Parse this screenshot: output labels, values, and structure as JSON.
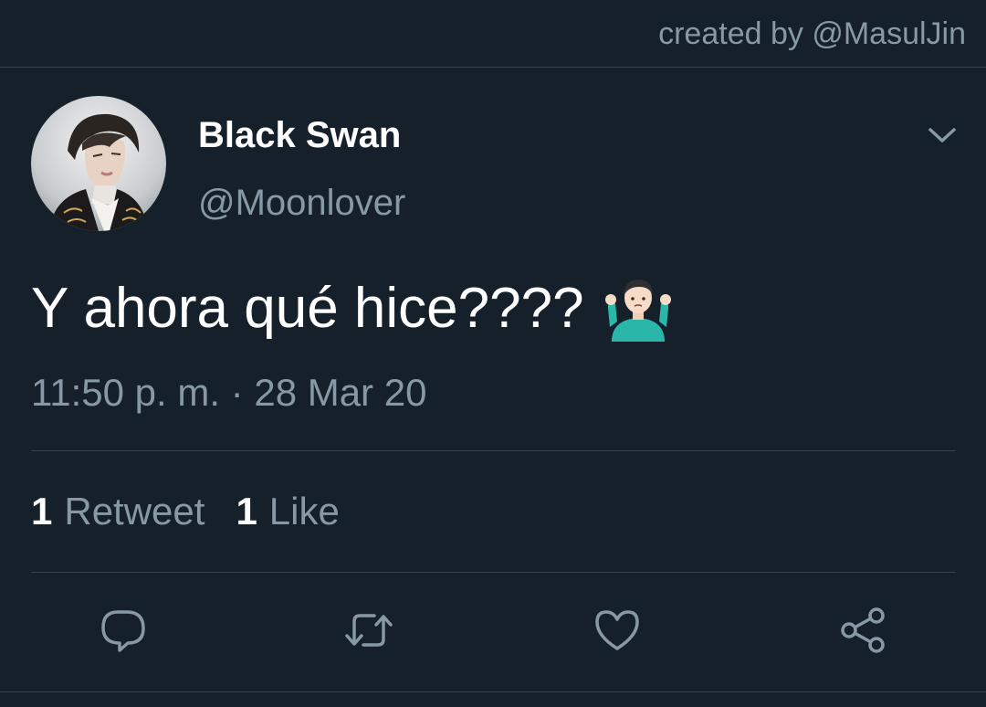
{
  "watermark": {
    "credit": "created by @MasulJin"
  },
  "tweet": {
    "display_name": "Black Swan",
    "handle": "@Moonlover",
    "text": "Y ahora qué hice????",
    "emoji": "person-shrugging-emoji",
    "timestamp": "11:50 p. m. · 28 Mar 20",
    "stats": {
      "retweets_count": "1",
      "retweets_label": "Retweet",
      "likes_count": "1",
      "likes_label": "Like"
    }
  },
  "actions": [
    {
      "icon": "reply-icon"
    },
    {
      "icon": "retweet-icon"
    },
    {
      "icon": "like-heart-icon"
    },
    {
      "icon": "share-icon"
    }
  ],
  "colors": {
    "background": "#15202b",
    "primary_text": "#ffffff",
    "secondary_text": "#8899a6",
    "divider": "#38444d"
  }
}
